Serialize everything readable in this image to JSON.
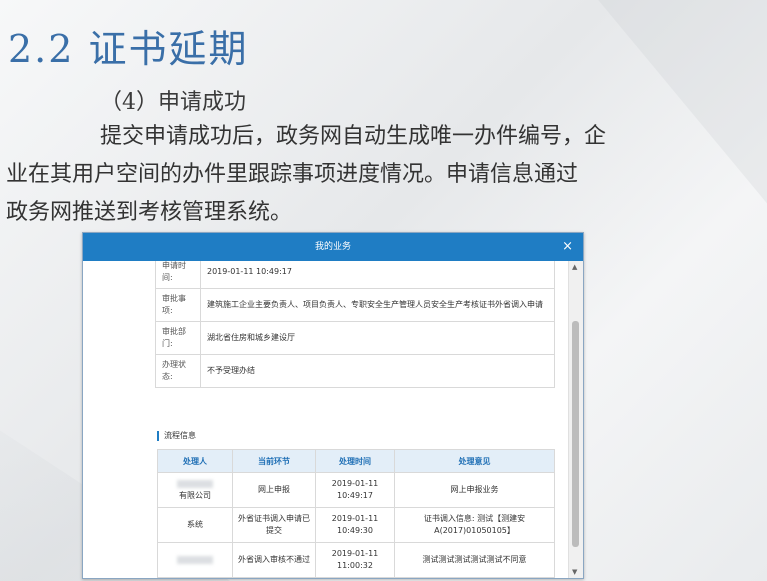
{
  "slide": {
    "title": "2.2 证书延期",
    "subtitle": "（4）申请成功",
    "paragraph_line1": "提交申请成功后，政务网自动生成唯一办件编号，企",
    "paragraph_line2": "业在其用户空间的办件里跟踪事项进度情况。申请信息通过",
    "paragraph_line3": "政务网推送到考核管理系统。"
  },
  "dialog": {
    "title": "我的业务",
    "close_label": "×",
    "info_rows": [
      {
        "label": "申请时间:",
        "value": "2019-01-11 10:49:17"
      },
      {
        "label": "审批事项:",
        "value": "建筑施工企业主要负责人、项目负责人、专职安全生产管理人员安全生产考核证书外省调入申请"
      },
      {
        "label": "审批部门:",
        "value": "湖北省住房和城乡建设厅"
      },
      {
        "label": "办理状态:",
        "value": "不予受理办结"
      }
    ],
    "section_title": "流程信息",
    "flow_headers": [
      "处理人",
      "当前环节",
      "处理时间",
      "处理意见"
    ],
    "flow_rows": [
      {
        "handler": "有限公司",
        "step": "网上申报",
        "time_date": "2019-01-11",
        "time_clock": "10:49:17",
        "opinion": "网上申报业务"
      },
      {
        "handler": "系统",
        "step": "外省证书调入申请已提交",
        "time_date": "2019-01-11",
        "time_clock": "10:49:30",
        "opinion": "证书调入信息: 测试【测建安A(2017)01050105】"
      },
      {
        "handler": "",
        "step": "外省调入审核不通过",
        "time_date": "2019-01-11",
        "time_clock": "11:00:32",
        "opinion": "测试测试测试测试测试不同意"
      }
    ]
  },
  "scrollbar": {
    "up_arrow": "▲",
    "down_arrow": "▼"
  }
}
